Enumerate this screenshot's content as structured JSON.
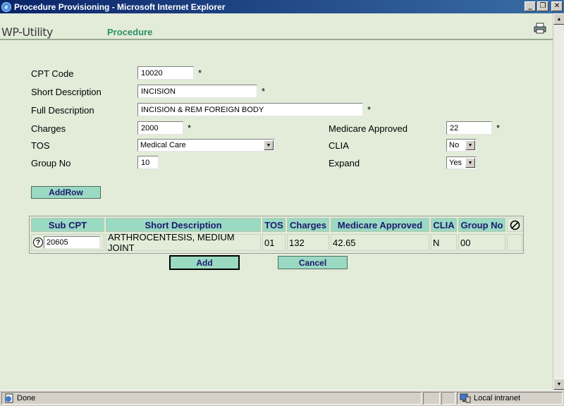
{
  "window": {
    "title": "Procedure Provisioning - Microsoft Internet Explorer"
  },
  "header": {
    "app_name": "WP-Utility",
    "section": "Procedure"
  },
  "form": {
    "cpt_code": {
      "label": "CPT Code",
      "value": "10020",
      "required": "*"
    },
    "short_description": {
      "label": "Short Description",
      "value": "INCISION",
      "required": "*"
    },
    "full_description": {
      "label": "Full Description",
      "value": "INCISION & REM FOREIGN BODY",
      "required": "*"
    },
    "charges": {
      "label": "Charges",
      "value": "2000",
      "required": "*"
    },
    "tos": {
      "label": "TOS",
      "value": "Medical Care"
    },
    "group_no": {
      "label": "Group No",
      "value": "10"
    },
    "medicare_approved": {
      "label": "Medicare Approved",
      "value": "22",
      "required": "*"
    },
    "clia": {
      "label": "CLIA",
      "value": "No"
    },
    "expand": {
      "label": "Expand",
      "value": "Yes"
    }
  },
  "add_row_label": "AddRow",
  "table": {
    "headers": [
      "Sub CPT",
      "Short Description",
      "TOS",
      "Charges",
      "Medicare Approved",
      "CLIA",
      "Group No"
    ],
    "rows": [
      {
        "sub_cpt": "20605",
        "short_description": "ARTHROCENTESIS, MEDIUM JOINT",
        "tos": "01",
        "charges": "132",
        "medicare_approved": "42.65",
        "clia": "N",
        "group_no": "00"
      }
    ]
  },
  "buttons": {
    "add": "Add",
    "cancel": "Cancel"
  },
  "status": {
    "text": "Done",
    "zone": "Local intranet"
  },
  "icons": [
    "ie-icon",
    "minimize-icon",
    "maximize-icon",
    "close-icon",
    "print-icon",
    "help-icon",
    "delete-icon",
    "page-icon",
    "intranet-icon"
  ],
  "colors": {
    "background": "#e2ecd9",
    "header_green": "#9ad9c2",
    "section_text": "#2d8f66",
    "title_bar": "#0a246a"
  }
}
